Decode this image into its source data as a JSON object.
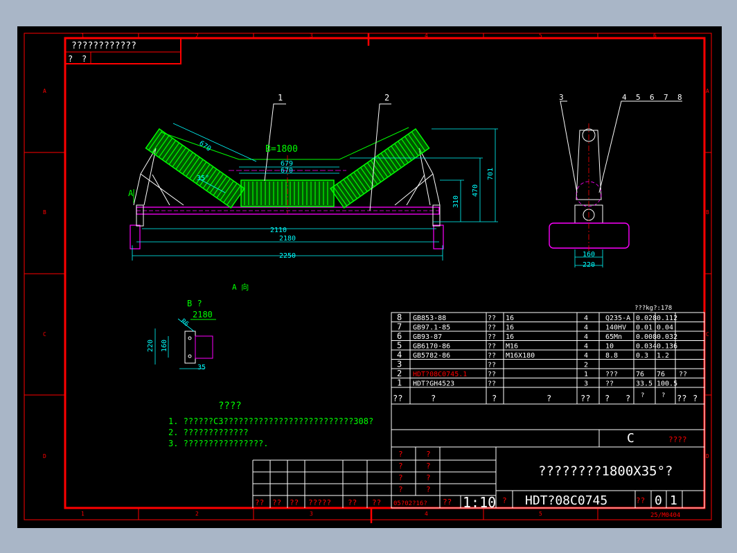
{
  "colors": {
    "frame": "#ff0000",
    "dim": "#00ffff",
    "roller": "#00ff00",
    "white": "#ffffff",
    "magenta": "#ff00ff",
    "yellow": "#ffff00"
  },
  "zone_columns": [
    "1",
    "2",
    "3",
    "4",
    "5",
    "6"
  ],
  "zone_rows": [
    "A",
    "B",
    "C",
    "D"
  ],
  "header_box": {
    "line1": "????????????",
    "cell1": "?",
    "cell2": "?"
  },
  "callouts_front": {
    "c1": "1",
    "c2": "2"
  },
  "callouts_side": {
    "c3": "3",
    "c4": "4",
    "c5": "5",
    "c6": "6",
    "c7": "7",
    "c8": "8"
  },
  "front_view": {
    "belt_label": "B=1800",
    "view_marker": "A",
    "dim_670_incline": "670",
    "dim_679": "679",
    "dim_670": "670",
    "dim_35": "35°",
    "dim_2110": "2110",
    "dim_2180": "2180",
    "dim_2250": "2250",
    "dim_310": "310",
    "dim_470": "470",
    "dim_701": "701",
    "view_caption": "A  向"
  },
  "side_view": {
    "dim_160": "160",
    "dim_220": "220"
  },
  "detail_b": {
    "title": "B ?",
    "dim_2180": "2180",
    "dim_220": "220",
    "dim_160": "160",
    "dim_35": "35",
    "dim_r": "R6"
  },
  "notes": {
    "title": "????",
    "items": [
      "1. ??????C3??????????????????????????308?",
      "2. ?????????????",
      "3. ????????????????."
    ]
  },
  "bom": {
    "weight_note": "???kg?:178",
    "rows": [
      {
        "no": "8",
        "code": "GB853-88",
        "name": "??",
        "spec": "16",
        "qty": "4",
        "mat": "Q235-A",
        "w1": "0.028",
        "w2": "0.112",
        "note": ""
      },
      {
        "no": "7",
        "code": "GB97.1-85",
        "name": "??",
        "spec": "16",
        "qty": "4",
        "mat": "140HV",
        "w1": "0.01",
        "w2": "0.04",
        "note": ""
      },
      {
        "no": "6",
        "code": "GB93-87",
        "name": "??",
        "spec": "16",
        "qty": "4",
        "mat": "65Mn",
        "w1": "0.008",
        "w2": "0.032",
        "note": ""
      },
      {
        "no": "5",
        "code": "GB6170-86",
        "name": "??",
        "spec": "M16",
        "qty": "4",
        "mat": "10",
        "w1": "0.034",
        "w2": "0.136",
        "note": ""
      },
      {
        "no": "4",
        "code": "GB5782-86",
        "name": "??",
        "spec": "M16X180",
        "qty": "4",
        "mat": "8.8",
        "w1": "0.3",
        "w2": "1.2",
        "note": ""
      },
      {
        "no": "3",
        "code": "",
        "name": "??",
        "spec": "",
        "qty": "2",
        "mat": "",
        "w1": "",
        "w2": "",
        "note": ""
      },
      {
        "no": "2",
        "code": "HDT?08C0745.1",
        "name": "??",
        "spec": "",
        "qty": "1",
        "mat": "???",
        "w1": "76",
        "w2": "76",
        "note": "??"
      },
      {
        "no": "1",
        "code": "HDT?GH4523",
        "name": "??",
        "spec": "",
        "qty": "3",
        "mat": "??",
        "w1": "33.5",
        "w2": "100.5",
        "note": ""
      }
    ],
    "header": {
      "no": "??",
      "code": "?",
      "name": "?",
      "spec": "?",
      "qty": "??",
      "mat": "?",
      "mat2": "?",
      "w1": "?",
      "w1b": "?",
      "w2": "?",
      "note": "??",
      "note2": "?"
    }
  },
  "title_block": {
    "stage_letter": "C",
    "stage_label": "????",
    "drawing_title": "????????1800X35°?",
    "drawing_no": "HDT?08C0745",
    "sheet_label": "??",
    "sheet_a": "0",
    "sheet_b": "1",
    "scale_label": "??",
    "scale": "1:10",
    "scale_prefix": "?",
    "sign_cells": [
      "?",
      "?",
      "?",
      "?",
      "?",
      "?",
      "?",
      "?"
    ],
    "bottom_row": [
      "??",
      "??",
      "??",
      "?????",
      "??",
      "??",
      "05?02?16?"
    ],
    "format": "25/M0404"
  }
}
